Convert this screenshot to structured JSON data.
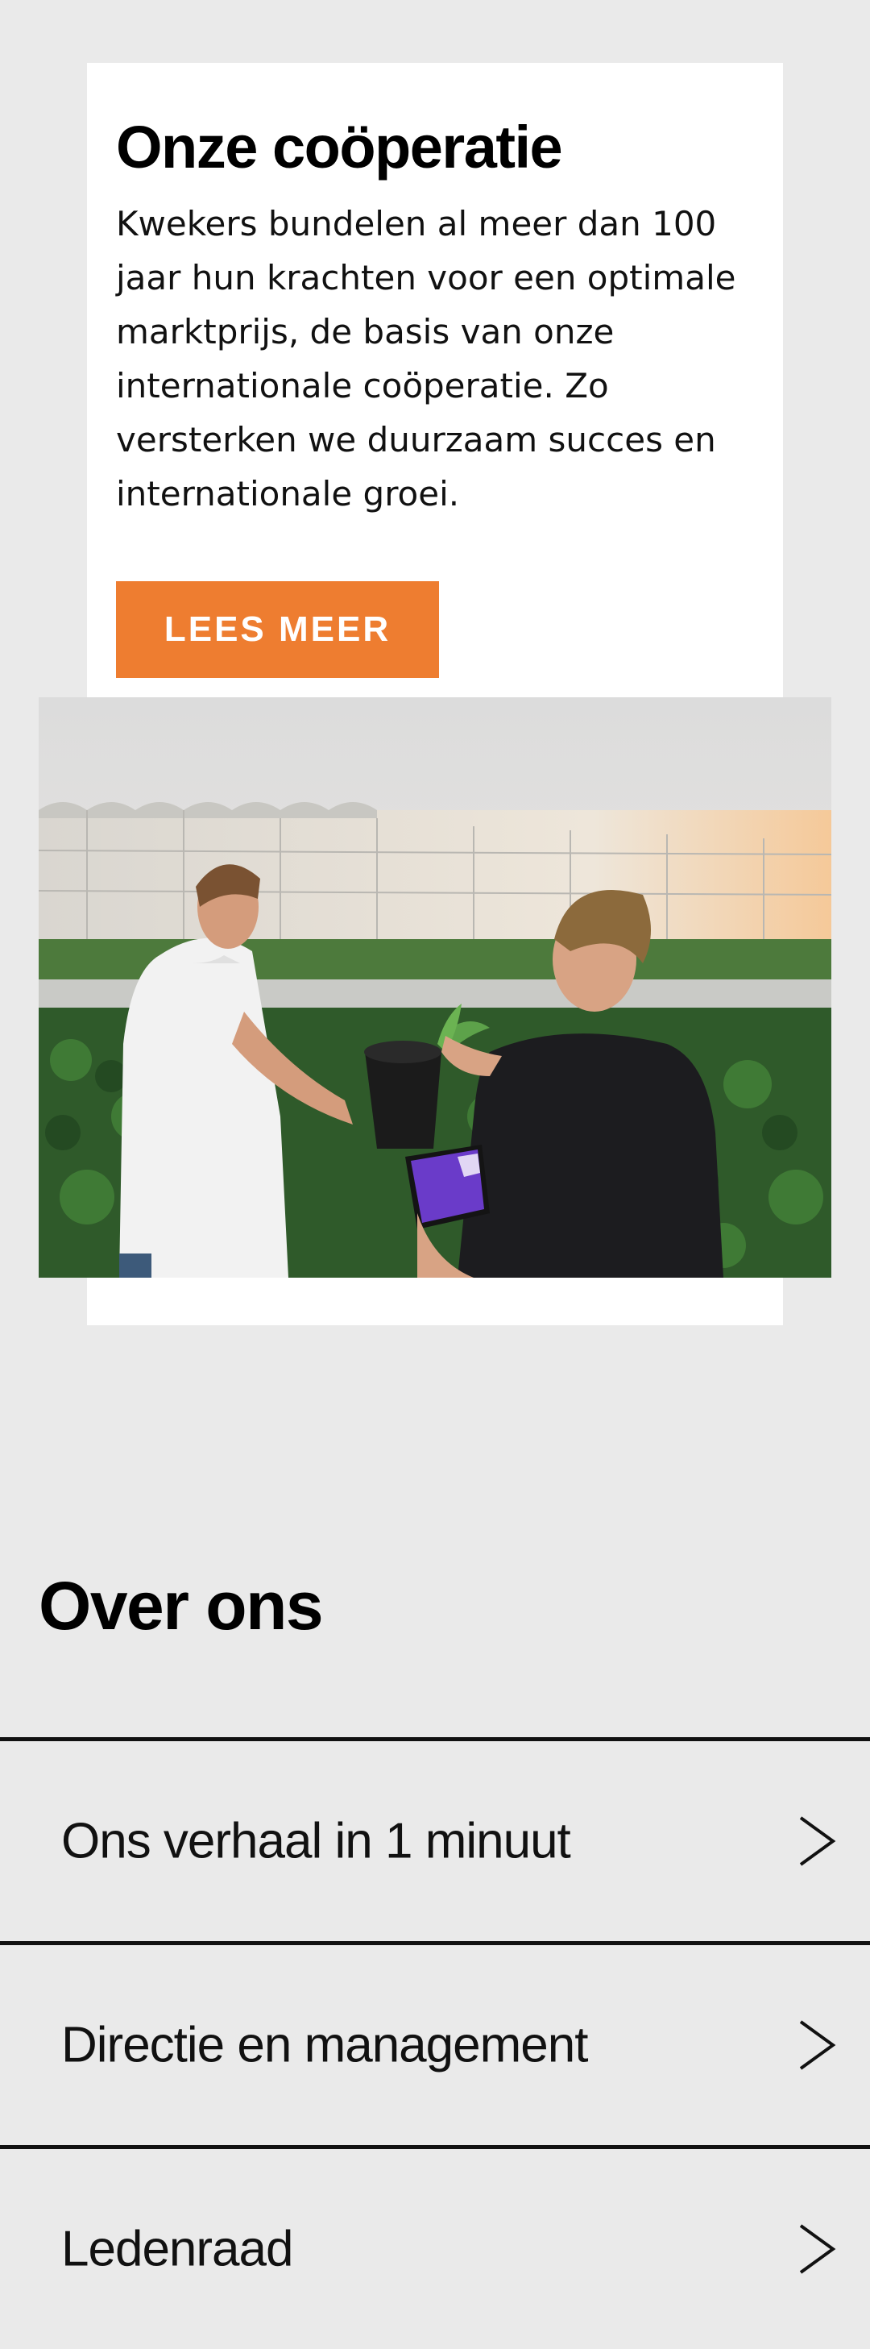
{
  "cooperation": {
    "title": "Onze coöperatie",
    "text": "Kwekers bundelen al meer dan 100 jaar hun krachten voor een optimale marktprijs, de basis van onze internationale coöperatie. Zo versterken we duurzaam succes en internationale groei.",
    "button_label": "LEES MEER",
    "image_icon": "photo-two-growers-with-plant-and-tablet-in-greenhouse-field"
  },
  "about": {
    "title": "Over ons",
    "items": [
      {
        "label": "Ons verhaal in 1 minuut",
        "icon": "chevron-right-icon"
      },
      {
        "label": "Directie en management",
        "icon": "chevron-right-icon"
      },
      {
        "label": "Ledenraad",
        "icon": "chevron-right-icon"
      }
    ]
  },
  "colors": {
    "background": "#eaeaea",
    "card": "#ffffff",
    "accent": "#ee7d30",
    "text": "#111111"
  }
}
